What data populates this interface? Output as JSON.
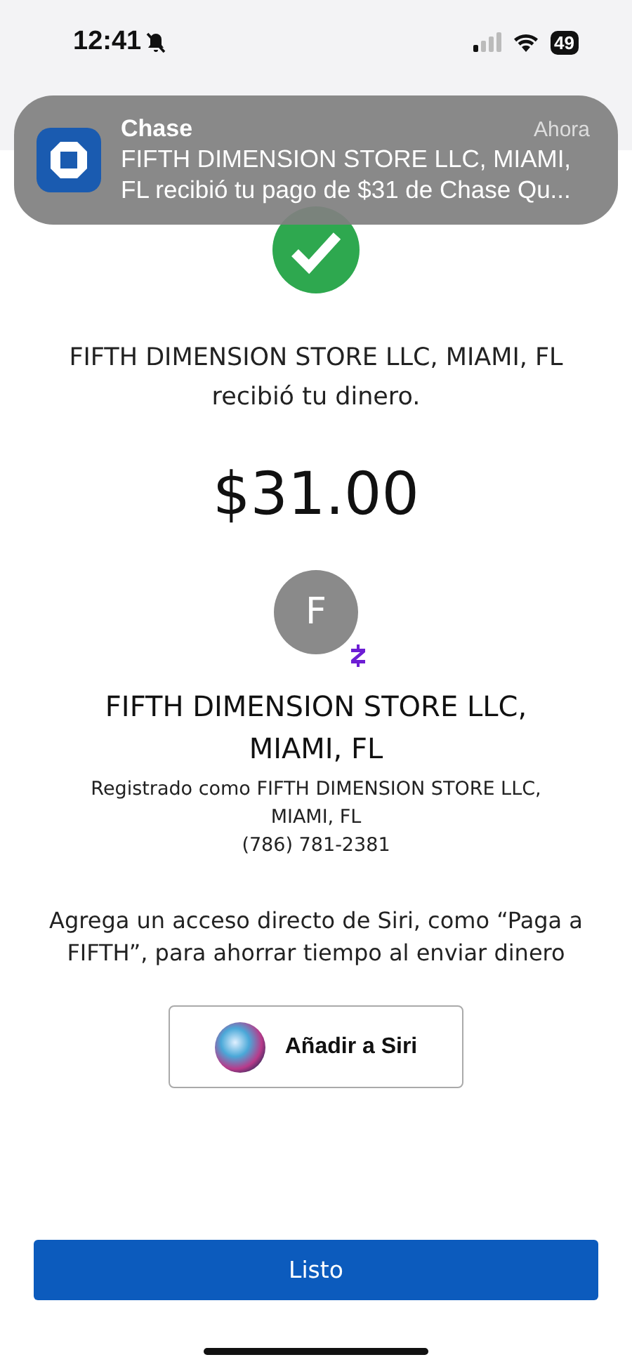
{
  "status_bar": {
    "time": "12:41",
    "silent": true,
    "battery": "49"
  },
  "notification": {
    "app": "Chase",
    "time": "Ahora",
    "message": "FIFTH DIMENSION STORE LLC, MIAMI, FL recibió tu pago de $31 de Chase Qu..."
  },
  "confirmation": {
    "message": "FIFTH DIMENSION STORE LLC, MIAMI, FL recibió tu dinero.",
    "amount": "$31.00"
  },
  "recipient": {
    "initial": "F",
    "name": "FIFTH DIMENSION STORE LLC, MIAMI, FL",
    "registered": "Registrado como FIFTH DIMENSION STORE LLC, MIAMI, FL",
    "phone": "(786) 781-2381"
  },
  "siri": {
    "prompt": "Agrega un acceso directo de Siri, como “Paga a FIFTH”, para ahorrar tiempo al enviar dinero",
    "button": "Añadir a Siri"
  },
  "done_button": "Listo"
}
